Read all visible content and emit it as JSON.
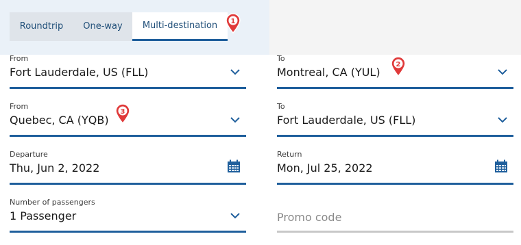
{
  "tabs": [
    "Roundtrip",
    "One-way",
    "Multi-destination"
  ],
  "selected_tab": "Multi-destination",
  "segments": [
    {
      "from_label": "From",
      "from_value": "Fort Lauderdale, US (FLL)",
      "to_label": "To",
      "to_value": "Montreal, CA (YUL)"
    },
    {
      "from_label": "From",
      "from_value": "Quebec, CA (YQB)",
      "to_label": "To",
      "to_value": "Fort Lauderdale, US (FLL)"
    }
  ],
  "departure": {
    "label": "Departure",
    "value": "Thu, Jun 2, 2022"
  },
  "return": {
    "label": "Return",
    "value": "Mon, Jul 25, 2022"
  },
  "passengers": {
    "label": "Number of passengers",
    "value": "1 Passenger"
  },
  "promo": {
    "placeholder": "Promo code"
  },
  "markers": [
    "1",
    "2",
    "3"
  ],
  "colors": {
    "accent": "#1f5f9c",
    "marker": "#e03a3a",
    "tab_bar": "#dfe4ea"
  }
}
